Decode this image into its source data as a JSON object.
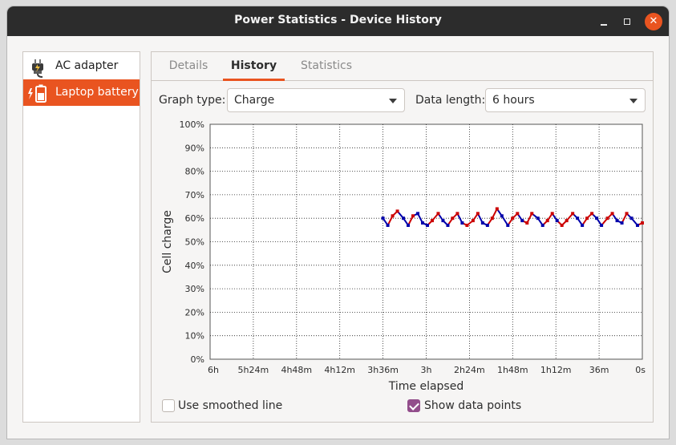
{
  "window": {
    "title": "Power Statistics - Device History"
  },
  "sidebar": {
    "items": [
      {
        "label": "AC adapter",
        "icon": "ac-adapter-icon"
      },
      {
        "label": "Laptop battery",
        "icon": "battery-icon",
        "selected": true
      }
    ]
  },
  "tabs": [
    {
      "label": "Details"
    },
    {
      "label": "History",
      "active": true
    },
    {
      "label": "Statistics"
    }
  ],
  "controls": {
    "graph_type_label": "Graph type:",
    "graph_type_value": "Charge",
    "data_length_label": "Data length:",
    "data_length_value": "6 hours",
    "smoothed_label": "Use smoothed line",
    "smoothed_checked": false,
    "points_label": "Show data points",
    "points_checked": true
  },
  "colors": {
    "accent": "#e95420",
    "check": "#924d8b",
    "charging": "#cc0000",
    "discharging": "#0000aa"
  },
  "chart_data": {
    "type": "line",
    "xlabel": "Time elapsed",
    "ylabel": "Cell charge",
    "x_ticks": [
      "6h",
      "5h24m",
      "4h48m",
      "4h12m",
      "3h36m",
      "3h",
      "2h24m",
      "1h48m",
      "1h12m",
      "36m",
      "0s"
    ],
    "y_ticks": [
      "100%",
      "90%",
      "80%",
      "70%",
      "60%",
      "50%",
      "40%",
      "30%",
      "20%",
      "10%",
      "0%"
    ],
    "ylim": [
      0,
      100
    ],
    "xlim_minutes_elapsed": [
      360,
      0
    ],
    "grid": true,
    "series": [
      {
        "x_minutes_ago": [
          216,
          212,
          208,
          204,
          199,
          195,
          191,
          187,
          183,
          179,
          175,
          170,
          166,
          162,
          158,
          154,
          150,
          146,
          141,
          137,
          133,
          129,
          125,
          121,
          117,
          112,
          108,
          104,
          100,
          96,
          92,
          87,
          83,
          79,
          75,
          71,
          67,
          63,
          58,
          54,
          50,
          46,
          42,
          38,
          34,
          29,
          25,
          21,
          17,
          13,
          9,
          4,
          0
        ],
        "values": [
          60,
          57,
          61,
          63,
          60,
          57,
          61,
          62,
          58,
          57,
          59,
          62,
          59,
          57,
          60,
          62,
          58,
          57,
          59,
          62,
          58,
          57,
          60,
          64,
          61,
          57,
          60,
          62,
          59,
          58,
          62,
          60,
          57,
          59,
          62,
          59,
          57,
          59,
          62,
          60,
          57,
          60,
          62,
          60,
          57,
          60,
          62,
          59,
          58,
          62,
          60,
          57,
          58
        ],
        "state": [
          "d",
          "d",
          "c",
          "c",
          "d",
          "d",
          "c",
          "d",
          "d",
          "d",
          "c",
          "c",
          "d",
          "d",
          "c",
          "c",
          "d",
          "c",
          "c",
          "c",
          "d",
          "d",
          "c",
          "c",
          "d",
          "d",
          "c",
          "c",
          "d",
          "c",
          "c",
          "d",
          "d",
          "c",
          "c",
          "d",
          "c",
          "c",
          "c",
          "d",
          "d",
          "c",
          "c",
          "d",
          "d",
          "c",
          "c",
          "d",
          "d",
          "c",
          "d",
          "d",
          "c"
        ]
      }
    ]
  }
}
